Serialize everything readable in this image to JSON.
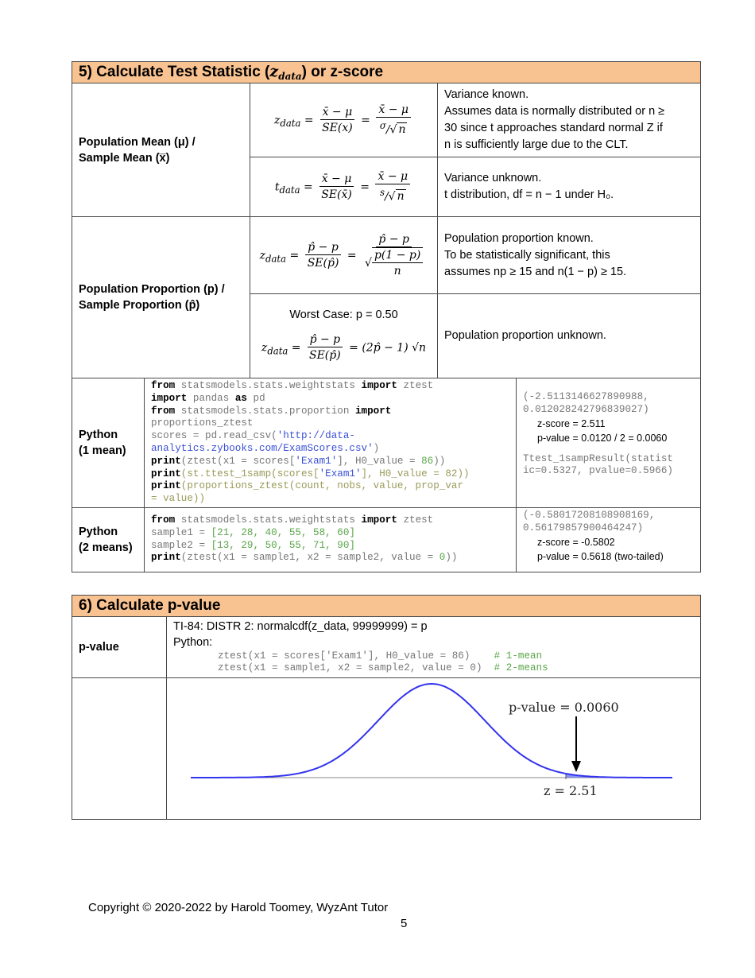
{
  "section5": {
    "title_prefix": "5)  Calculate Test Statistic (",
    "title_math": "z",
    "title_sub": "data",
    "title_suffix": ") or z-score",
    "rows": [
      {
        "label_line1": "Population Mean (μ) /",
        "label_line2": "Sample Mean (x̅)",
        "formulas": [
          {
            "lhs": "z",
            "lhs_sub": "data",
            "f1_num": "x̄ − μ",
            "f1_den": "SE(x)",
            "f2_num": "x̄ − μ",
            "f2_den_a": "σ",
            "f2_den_b": "n",
            "desc_lines": [
              "Variance known.",
              "Assumes data is normally distributed or n ≥",
              "30 since t approaches standard normal Z if",
              "n is sufficiently large due to the CLT."
            ]
          },
          {
            "lhs": "t",
            "lhs_sub": "data",
            "f1_num": "x̄ − μ",
            "f1_den": "SE(x̄)",
            "f2_num": "x̄ − μ",
            "f2_den_a": "s",
            "f2_den_b": "n",
            "desc_lines": [
              "Variance unknown.",
              "t distribution, df = n − 1 under H₀."
            ]
          }
        ]
      },
      {
        "label_line1": "Population Proportion (p) /",
        "label_line2": "Sample Proportion (p̂)",
        "formulas": [
          {
            "lhs": "z",
            "lhs_sub": "data",
            "f1_num": "p̂ − p",
            "f1_den": "SE(p̂)",
            "f2_num": "p̂ − p",
            "f2_den_num": "p(1 − p)",
            "f2_den_den": "n",
            "desc_lines": [
              "Population proportion known.",
              "To be statistically significant, this",
              "assumes np ≥ 15 and n(1 − p) ≥ 15."
            ]
          },
          {
            "worst_case": "Worst Case: p = 0.50",
            "lhs": "z",
            "lhs_sub": "data",
            "f1_num": "p̂ − p",
            "f1_den": "SE(p̂)",
            "rhs": "= (2p̂ − 1) √n",
            "desc_lines": [
              "Population proportion unknown."
            ]
          }
        ]
      }
    ],
    "python_1mean": {
      "label_line1": "Python",
      "label_line2": "(1 mean)",
      "output_tuple_1": "(-2.5113146627890988,",
      "output_tuple_2": "0.012028242796839027)",
      "note_z": "z-score = 2.511",
      "note_p": "p-value = 0.0120 / 2 = 0.0060",
      "ttest_1": "Ttest_1sampResult(statist",
      "ttest_2": "ic=0.5327, pvalue=0.5966)"
    },
    "python_2means": {
      "label_line1": "Python",
      "label_line2": "(2 means)",
      "output_tuple_1": "(-0.58017208108908169,",
      "output_tuple_2": "0.56179857900464247)",
      "note_z": "z-score = -0.5802",
      "note_p": "p-value = 0.5618 (two-tailed)"
    }
  },
  "section6": {
    "title": "6)  Calculate p-value",
    "label": "p-value",
    "ti84": "TI-84: DISTR 2: normalcdf(z_data, 99999999) = p",
    "python_label": "Python:",
    "code_1": "ztest(x1 = scores['Exam1'], H0_value = 86)",
    "comment_1": "# 1-mean",
    "code_2": "ztest(x1 = sample1, x2 = sample2, value = 0)",
    "comment_2": "# 2-means",
    "figure": {
      "pvalue_label": "p-value = 0.0060",
      "z_label": "z = 2.51"
    }
  },
  "chart_data": {
    "type": "line",
    "title": "",
    "description": "Standard normal density curve with right-tail area shaded beyond z = 2.51",
    "x_range": [
      -4.5,
      4.5
    ],
    "mean": 0,
    "sd": 1,
    "shaded_from_z": 2.51,
    "annotations": [
      "p-value = 0.0060",
      "z = 2.51"
    ],
    "curve_color": "#3333ee"
  },
  "footer": {
    "copyright": "Copyright © 2020-2022 by Harold Toomey, WyzAnt Tutor",
    "page_number": "5"
  },
  "colors": {
    "header_bg": "#f8c291",
    "string_blue": "#3a4fd6",
    "number_green": "#5aa54a",
    "curve_blue": "#3333ee"
  }
}
